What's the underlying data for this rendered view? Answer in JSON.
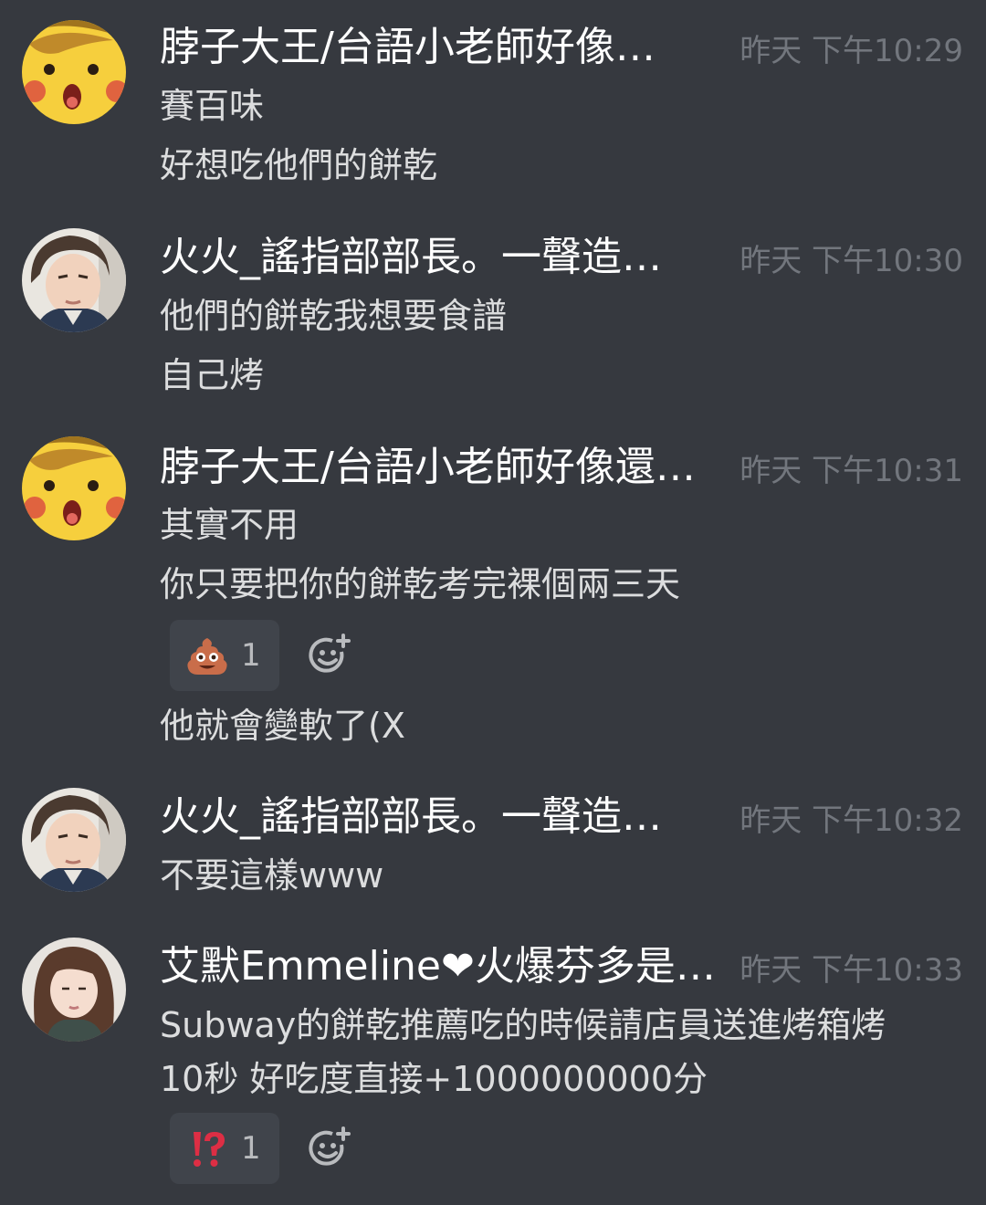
{
  "messages": [
    {
      "author": "脖子大王/台語小老師好像…",
      "timestamp": "昨天 下午10:29",
      "avatar": "pikachu-avatar",
      "lines": [
        "賽百味",
        "好想吃他們的餅乾"
      ]
    },
    {
      "author": "火火_謠指部部長。一聲造…",
      "timestamp": "昨天 下午10:30",
      "avatar": "user-photo-avatar",
      "lines": [
        "他們的餅乾我想要食譜",
        "自己烤"
      ]
    },
    {
      "author": "脖子大王/台語小老師好像還…",
      "timestamp": "昨天 下午10:31",
      "avatar": "pikachu-avatar",
      "lines": [
        "其實不用",
        "你只要把你的餅乾考完裸個兩三天"
      ],
      "reaction": {
        "emoji": "poop-emoji",
        "count": "1"
      },
      "after_reaction": "他就會變軟了(X"
    },
    {
      "author": "火火_謠指部部長。一聲造…",
      "timestamp": "昨天 下午10:32",
      "avatar": "user-photo-avatar",
      "lines": [
        "不要這樣www"
      ]
    },
    {
      "author": "艾默Emmeline❤火爆芬多是…",
      "timestamp": "昨天 下午10:33",
      "avatar": "girl-photo-avatar",
      "lines": [
        "Subway的餅乾推薦吃的時候請店員送進烤箱烤",
        "10秒  好吃度直接+1000000000分"
      ],
      "reaction": {
        "emoji": "interrobang-emoji",
        "count": "1"
      }
    }
  ],
  "colors": {
    "background": "#36393f",
    "author": "#ffffff",
    "timestamp": "#72767d",
    "body_text": "#dcddde",
    "reaction_bg": "#40444b"
  }
}
